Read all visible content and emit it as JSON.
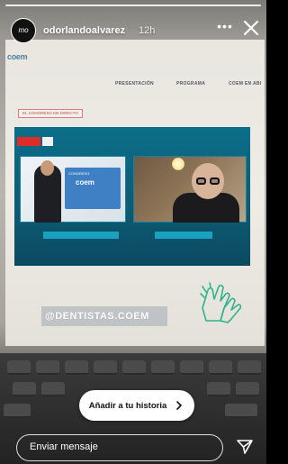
{
  "story": {
    "username": "odorlandoalvarez",
    "time_ago": "12h",
    "avatar_text": "mo",
    "more_label": "•••"
  },
  "photo": {
    "site_logo": "coem",
    "nav": [
      "PRESENTACIÓN",
      "PROGRAMA",
      "COEM EN ABI"
    ],
    "live_tag": "EL CONGRESO EN DIRECTO",
    "banner_text": "CONGRESO",
    "banner_logo": "coem",
    "handle": "@DENTISTAS.COEM"
  },
  "actions": {
    "add_to_story": "Añadir a tu historia",
    "message_placeholder": "Enviar mensaje"
  },
  "colors": {
    "accent_live": "#e02b2b",
    "video_frame": "#0d5a73",
    "clap_icon": "#2fb38e"
  },
  "icons": {
    "close": "close-icon",
    "more": "more-icon",
    "send": "send-icon",
    "chevron": "chevron-right-icon",
    "clap": "clapping-hands-icon"
  }
}
